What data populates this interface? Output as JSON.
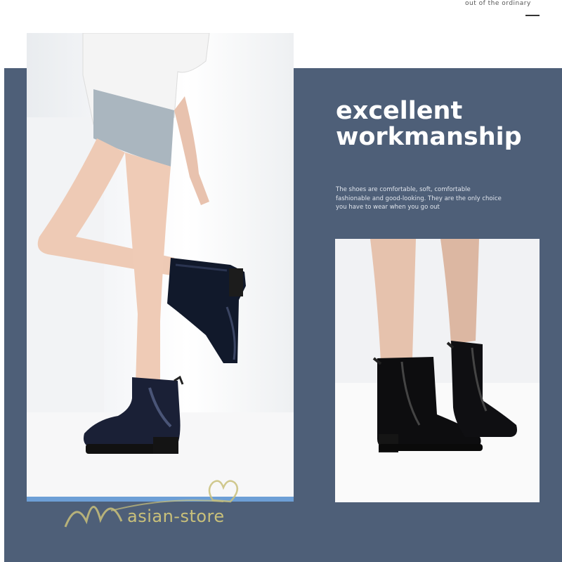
{
  "header": {
    "tagline": "out of the ordinary"
  },
  "feature": {
    "headline_line1": "excellent",
    "headline_line2": "workmanship",
    "description_lines": [
      "The shoes are comfortable, soft, comfortable",
      "fashionable and good-looking. They are the only choice",
      "you have to wear when you go out"
    ]
  },
  "watermark": {
    "text": "asian-store"
  },
  "colors": {
    "panel": "#4e5f78",
    "accent_strip": "#6d9fd6",
    "boot": "#0e1422",
    "watermark": "#c9c07a"
  },
  "images": {
    "left_photo": "model-wearing-navy-rain-boots-photo",
    "right_photo": "black-ankle-rain-boots-photo"
  }
}
